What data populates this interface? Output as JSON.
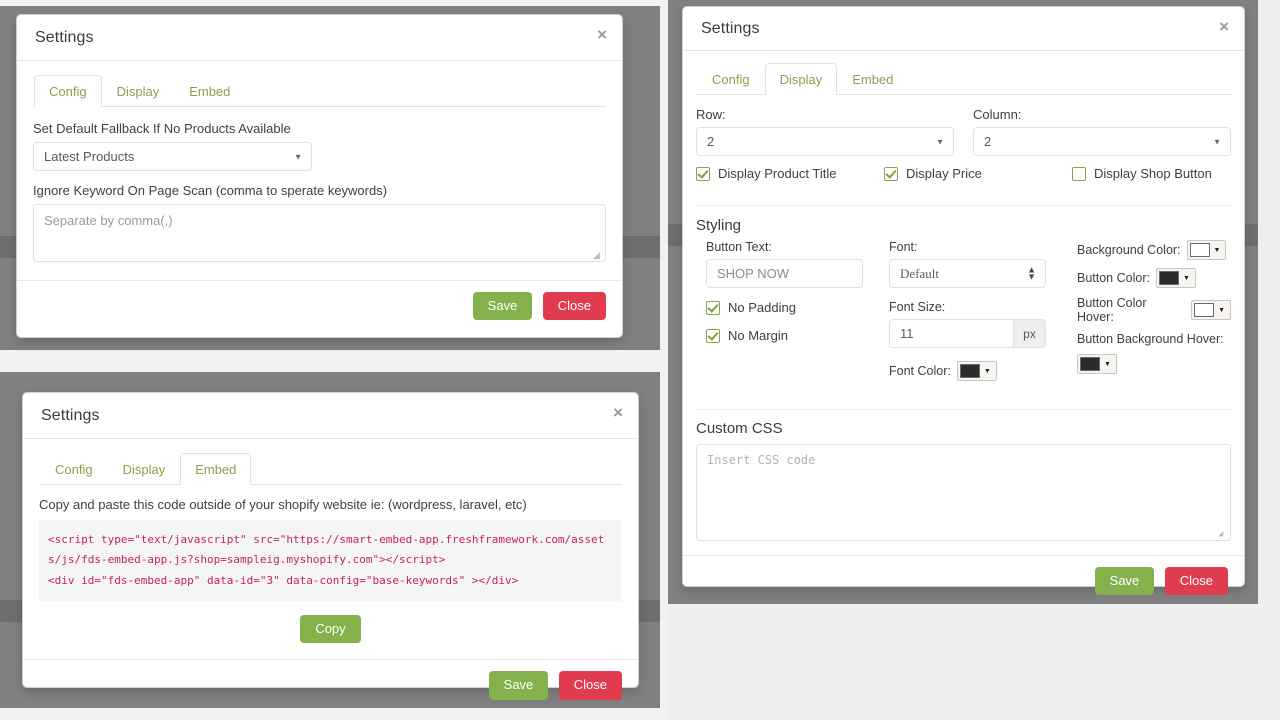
{
  "theme": {
    "tab_green": "#8ba14f",
    "save_green": "#84b14c",
    "close_red": "#e13b4e",
    "code_pink": "#c7254e",
    "backdrop_gray": "#808080",
    "page_gray": "#f0f1f2"
  },
  "panel_config": {
    "title": "Settings",
    "close_icon": "close-icon",
    "close_glyph": "×",
    "tabs": [
      {
        "label": "Config",
        "active": true
      },
      {
        "label": "Display",
        "active": false
      },
      {
        "label": "Embed",
        "active": false
      }
    ],
    "fallback_label": "Set Default Fallback If No Products Available",
    "fallback_value": "Latest Products",
    "ignore_label": "Ignore Keyword On Page Scan (comma to sperate keywords)",
    "ignore_placeholder": "Separate by comma(,)",
    "save_label": "Save",
    "close_label": "Close"
  },
  "panel_embed": {
    "title": "Settings",
    "close_glyph": "×",
    "tabs": [
      {
        "label": "Config",
        "active": false
      },
      {
        "label": "Display",
        "active": false
      },
      {
        "label": "Embed",
        "active": true
      }
    ],
    "instruction": "Copy and paste this code outside of your shopify website ie: (wordpress, laravel, etc)",
    "code_line_1": "<script type=\"text/javascript\" src=\"https://smart-embed-app.freshframework.com/assets/js/fds-embed-app.js?shop=sampleig.myshopify.com\"></script>",
    "code_line_2": "<div id=\"fds-embed-app\" data-id=\"3\" data-config=\"base-keywords\" ></div>",
    "copy_label": "Copy",
    "save_label": "Save",
    "close_label": "Close"
  },
  "panel_display": {
    "title": "Settings",
    "close_glyph": "×",
    "tabs": [
      {
        "label": "Config",
        "active": false
      },
      {
        "label": "Display",
        "active": true
      },
      {
        "label": "Embed",
        "active": false
      }
    ],
    "row_label": "Row:",
    "row_value": "2",
    "column_label": "Column:",
    "column_value": "2",
    "checkboxes": [
      {
        "label": "Display Product Title",
        "checked": true
      },
      {
        "label": "Display Price",
        "checked": true
      },
      {
        "label": "Display Shop Button",
        "checked": false
      }
    ],
    "styling_title": "Styling",
    "button_text_label": "Button Text:",
    "button_text_value": "SHOP NOW",
    "no_padding_label": "No Padding",
    "no_padding_checked": true,
    "no_margin_label": "No Margin",
    "no_margin_checked": true,
    "font_label": "Font:",
    "font_value": "Default",
    "font_size_label": "Font Size:",
    "font_size_value": "11",
    "font_size_unit": "px",
    "font_color_label": "Font Color:",
    "font_color_value": "#2b2b2b",
    "background_color_label": "Background Color:",
    "background_color_value": "#ffffff",
    "button_color_label": "Button Color:",
    "button_color_value": "#2b2b2b",
    "button_color_hover_label": "Button Color Hover:",
    "button_color_hover_value": "#ffffff",
    "button_background_hover_label": "Button Background Hover:",
    "button_background_hover_value": "#2b2b2b",
    "custom_css_title": "Custom CSS",
    "custom_css_placeholder": "Insert CSS code",
    "save_label": "Save",
    "close_label": "Close"
  }
}
